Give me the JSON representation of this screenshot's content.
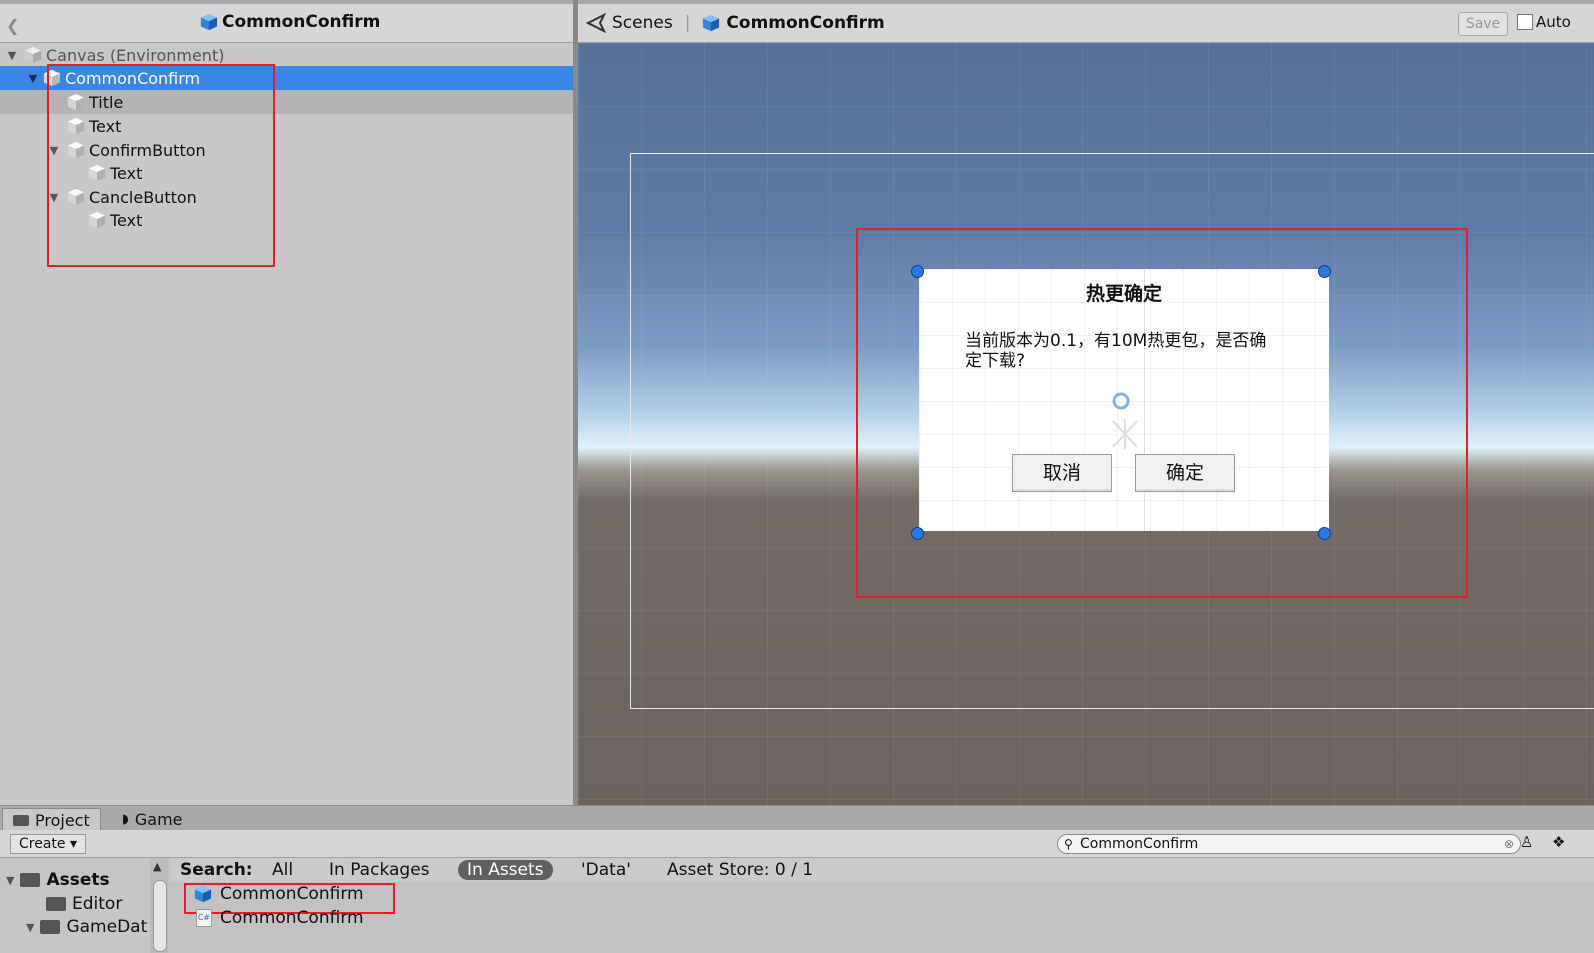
{
  "hierarchy": {
    "title": "CommonConfirm",
    "items": [
      {
        "label": "Canvas (Environment)"
      },
      {
        "label": "CommonConfirm"
      },
      {
        "label": "Title"
      },
      {
        "label": "Text"
      },
      {
        "label": "ConfirmButton"
      },
      {
        "label": "Text"
      },
      {
        "label": "CancleButton"
      },
      {
        "label": "Text"
      }
    ]
  },
  "scene": {
    "tab_label": "Scenes",
    "prefab_title": "CommonConfirm",
    "save_label": "Save",
    "auto_label": "Auto"
  },
  "dialog": {
    "title": "热更确定",
    "message_line1": "当前版本为0.1，有10M热更包，是否确",
    "message_line2": "定下载?",
    "cancel_label": "取消",
    "confirm_label": "确定"
  },
  "bottom": {
    "tab_project": "Project",
    "tab_game": "Game",
    "create_label": "Create",
    "search_value": "CommonConfirm",
    "tree": [
      {
        "label": "Assets"
      },
      {
        "label": "Editor"
      },
      {
        "label": "GameDat"
      }
    ],
    "search": {
      "label": "Search:",
      "all": "All",
      "in_packages": "In Packages",
      "in_assets": "In Assets",
      "data": "'Data'",
      "asset_store": "Asset Store: 0 / 1"
    },
    "results": [
      {
        "label": "CommonConfirm"
      },
      {
        "label": "CommonConfirm"
      }
    ]
  },
  "colors": {
    "selection": "#3a85e5",
    "highlight_red": "#e0202a",
    "handle_blue": "#2a79e0"
  }
}
